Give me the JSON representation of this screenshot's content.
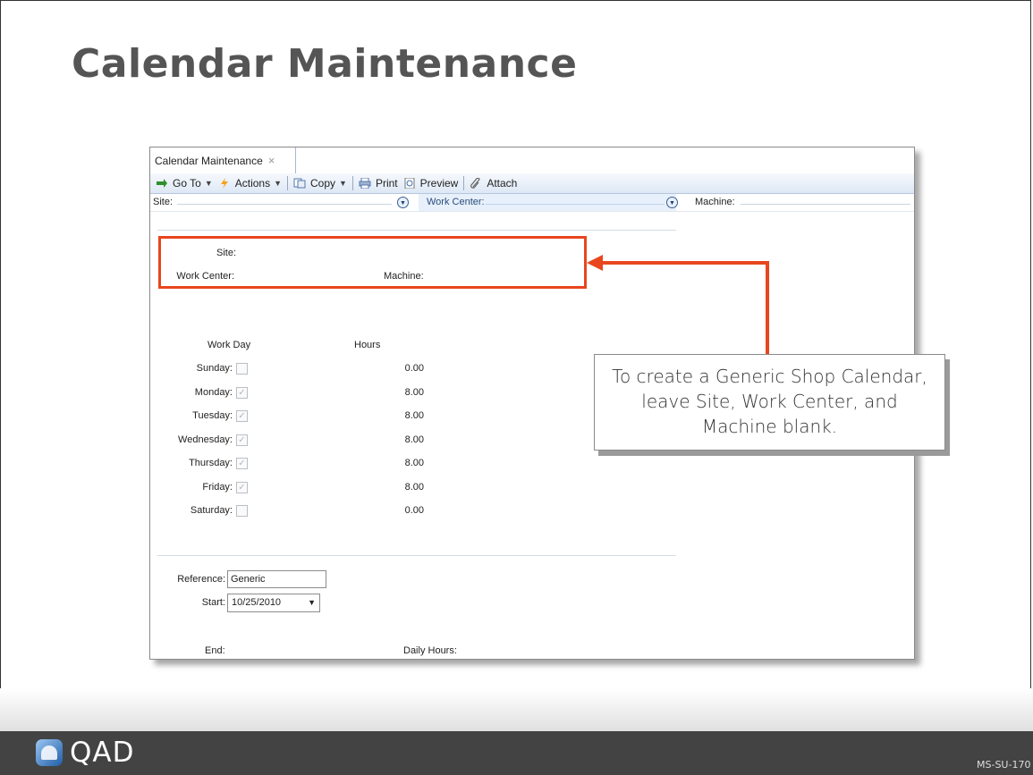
{
  "slide": {
    "title": "Calendar Maintenance",
    "code": "MS-SU-170",
    "logo_text": "QAD"
  },
  "window": {
    "tab_label": "Calendar Maintenance",
    "tab_close": "×"
  },
  "toolbar": {
    "goto_label": "Go To",
    "actions_label": "Actions",
    "copy_label": "Copy",
    "print_label": "Print",
    "preview_label": "Preview",
    "attach_label": "Attach"
  },
  "filter": {
    "site_label": "Site:",
    "work_center_label": "Work Center:",
    "machine_label": "Machine:"
  },
  "header_fields": {
    "site_label": "Site:",
    "work_center_label": "Work Center:",
    "machine_label": "Machine:"
  },
  "schedule": {
    "work_day_header": "Work Day",
    "hours_header": "Hours",
    "days": [
      {
        "label": "Sunday:",
        "checked": false,
        "hours": "0.00"
      },
      {
        "label": "Monday:",
        "checked": true,
        "hours": "8.00"
      },
      {
        "label": "Tuesday:",
        "checked": true,
        "hours": "8.00"
      },
      {
        "label": "Wednesday:",
        "checked": true,
        "hours": "8.00"
      },
      {
        "label": "Thursday:",
        "checked": true,
        "hours": "8.00"
      },
      {
        "label": "Friday:",
        "checked": true,
        "hours": "8.00"
      },
      {
        "label": "Saturday:",
        "checked": false,
        "hours": "0.00"
      }
    ]
  },
  "bottom_fields": {
    "reference_label": "Reference:",
    "reference_value": "Generic",
    "start_label": "Start:",
    "start_value": "10/25/2010",
    "end_label": "End:",
    "daily_hours_label": "Daily Hours:"
  },
  "callout": {
    "text": "To create a Generic Shop Calendar, leave Site,  Work Center, and Machine blank."
  },
  "colors": {
    "highlight": "#e8461e",
    "footer": "#434343",
    "toolbar_bg": "#dde8f5"
  }
}
